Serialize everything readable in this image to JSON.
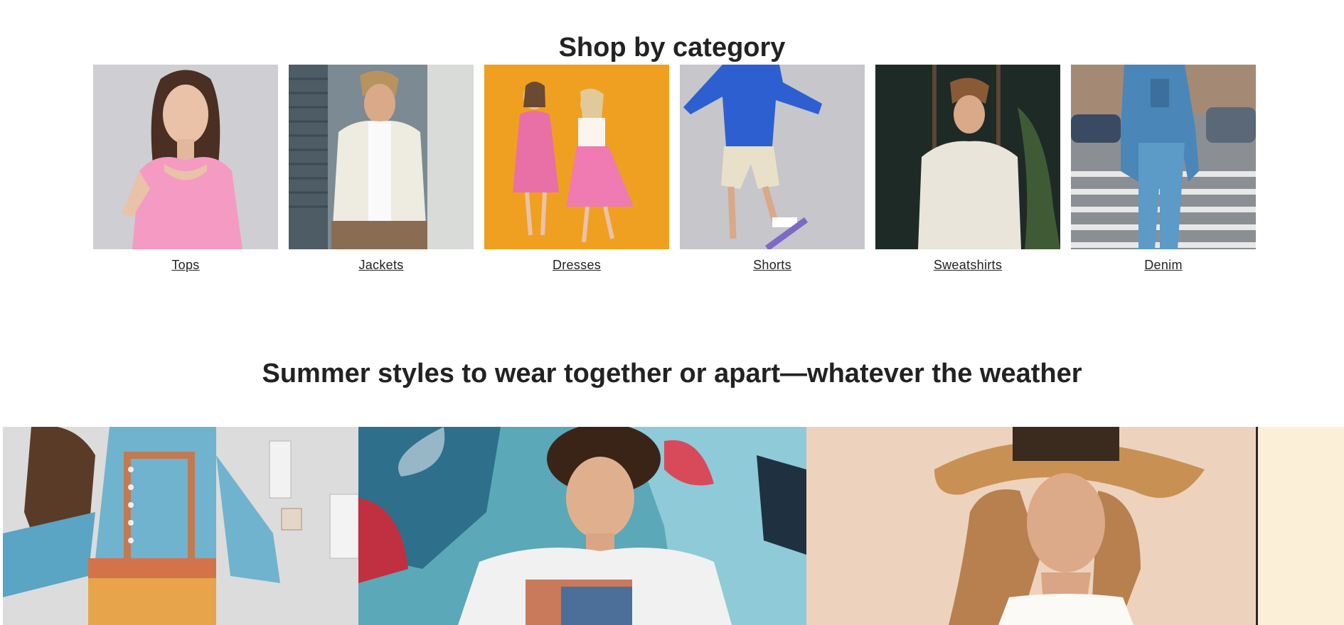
{
  "section_category": {
    "title": "Shop by category",
    "items": [
      {
        "label": "Tops",
        "image": "woman-in-pink-top"
      },
      {
        "label": "Jackets",
        "image": "man-in-white-jacket"
      },
      {
        "label": "Dresses",
        "image": "two-women-in-pink-dresses"
      },
      {
        "label": "Shorts",
        "image": "man-in-shorts-on-skateboard"
      },
      {
        "label": "Sweatshirts",
        "image": "man-in-cream-sweatshirt"
      },
      {
        "label": "Denim",
        "image": "woman-in-denim-outfit"
      }
    ]
  },
  "section_summer": {
    "title": "Summer styles to wear together or apart—whatever the weather",
    "tiles": [
      {
        "image": "woman-in-embroidered-blue-dress"
      },
      {
        "image": "man-in-graphic-tee-with-graffiti"
      },
      {
        "image": "woman-in-straw-hat"
      },
      {
        "image": "partial-cream-tile"
      }
    ]
  },
  "colors": {
    "text": "#222222",
    "background": "#ffffff",
    "dresses_bg": "#f0a020",
    "tops_bg": "#cfcfd4",
    "shorts_bg": "#c6c6cb"
  }
}
